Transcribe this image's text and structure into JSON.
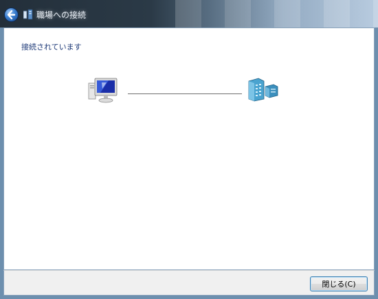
{
  "window": {
    "title": "職場への接続",
    "back_icon": "back-arrow-icon",
    "app_icon": "network-connection-icon"
  },
  "status": {
    "text": "接続されています"
  },
  "diagram": {
    "local_icon": "computer-icon",
    "remote_icon": "server-icon",
    "line_color": "#6f6f6f"
  },
  "footer": {
    "close_label": "閉じる(C)"
  },
  "colors": {
    "accent": "#1e3a78",
    "button_border": "#3c7fb1"
  }
}
